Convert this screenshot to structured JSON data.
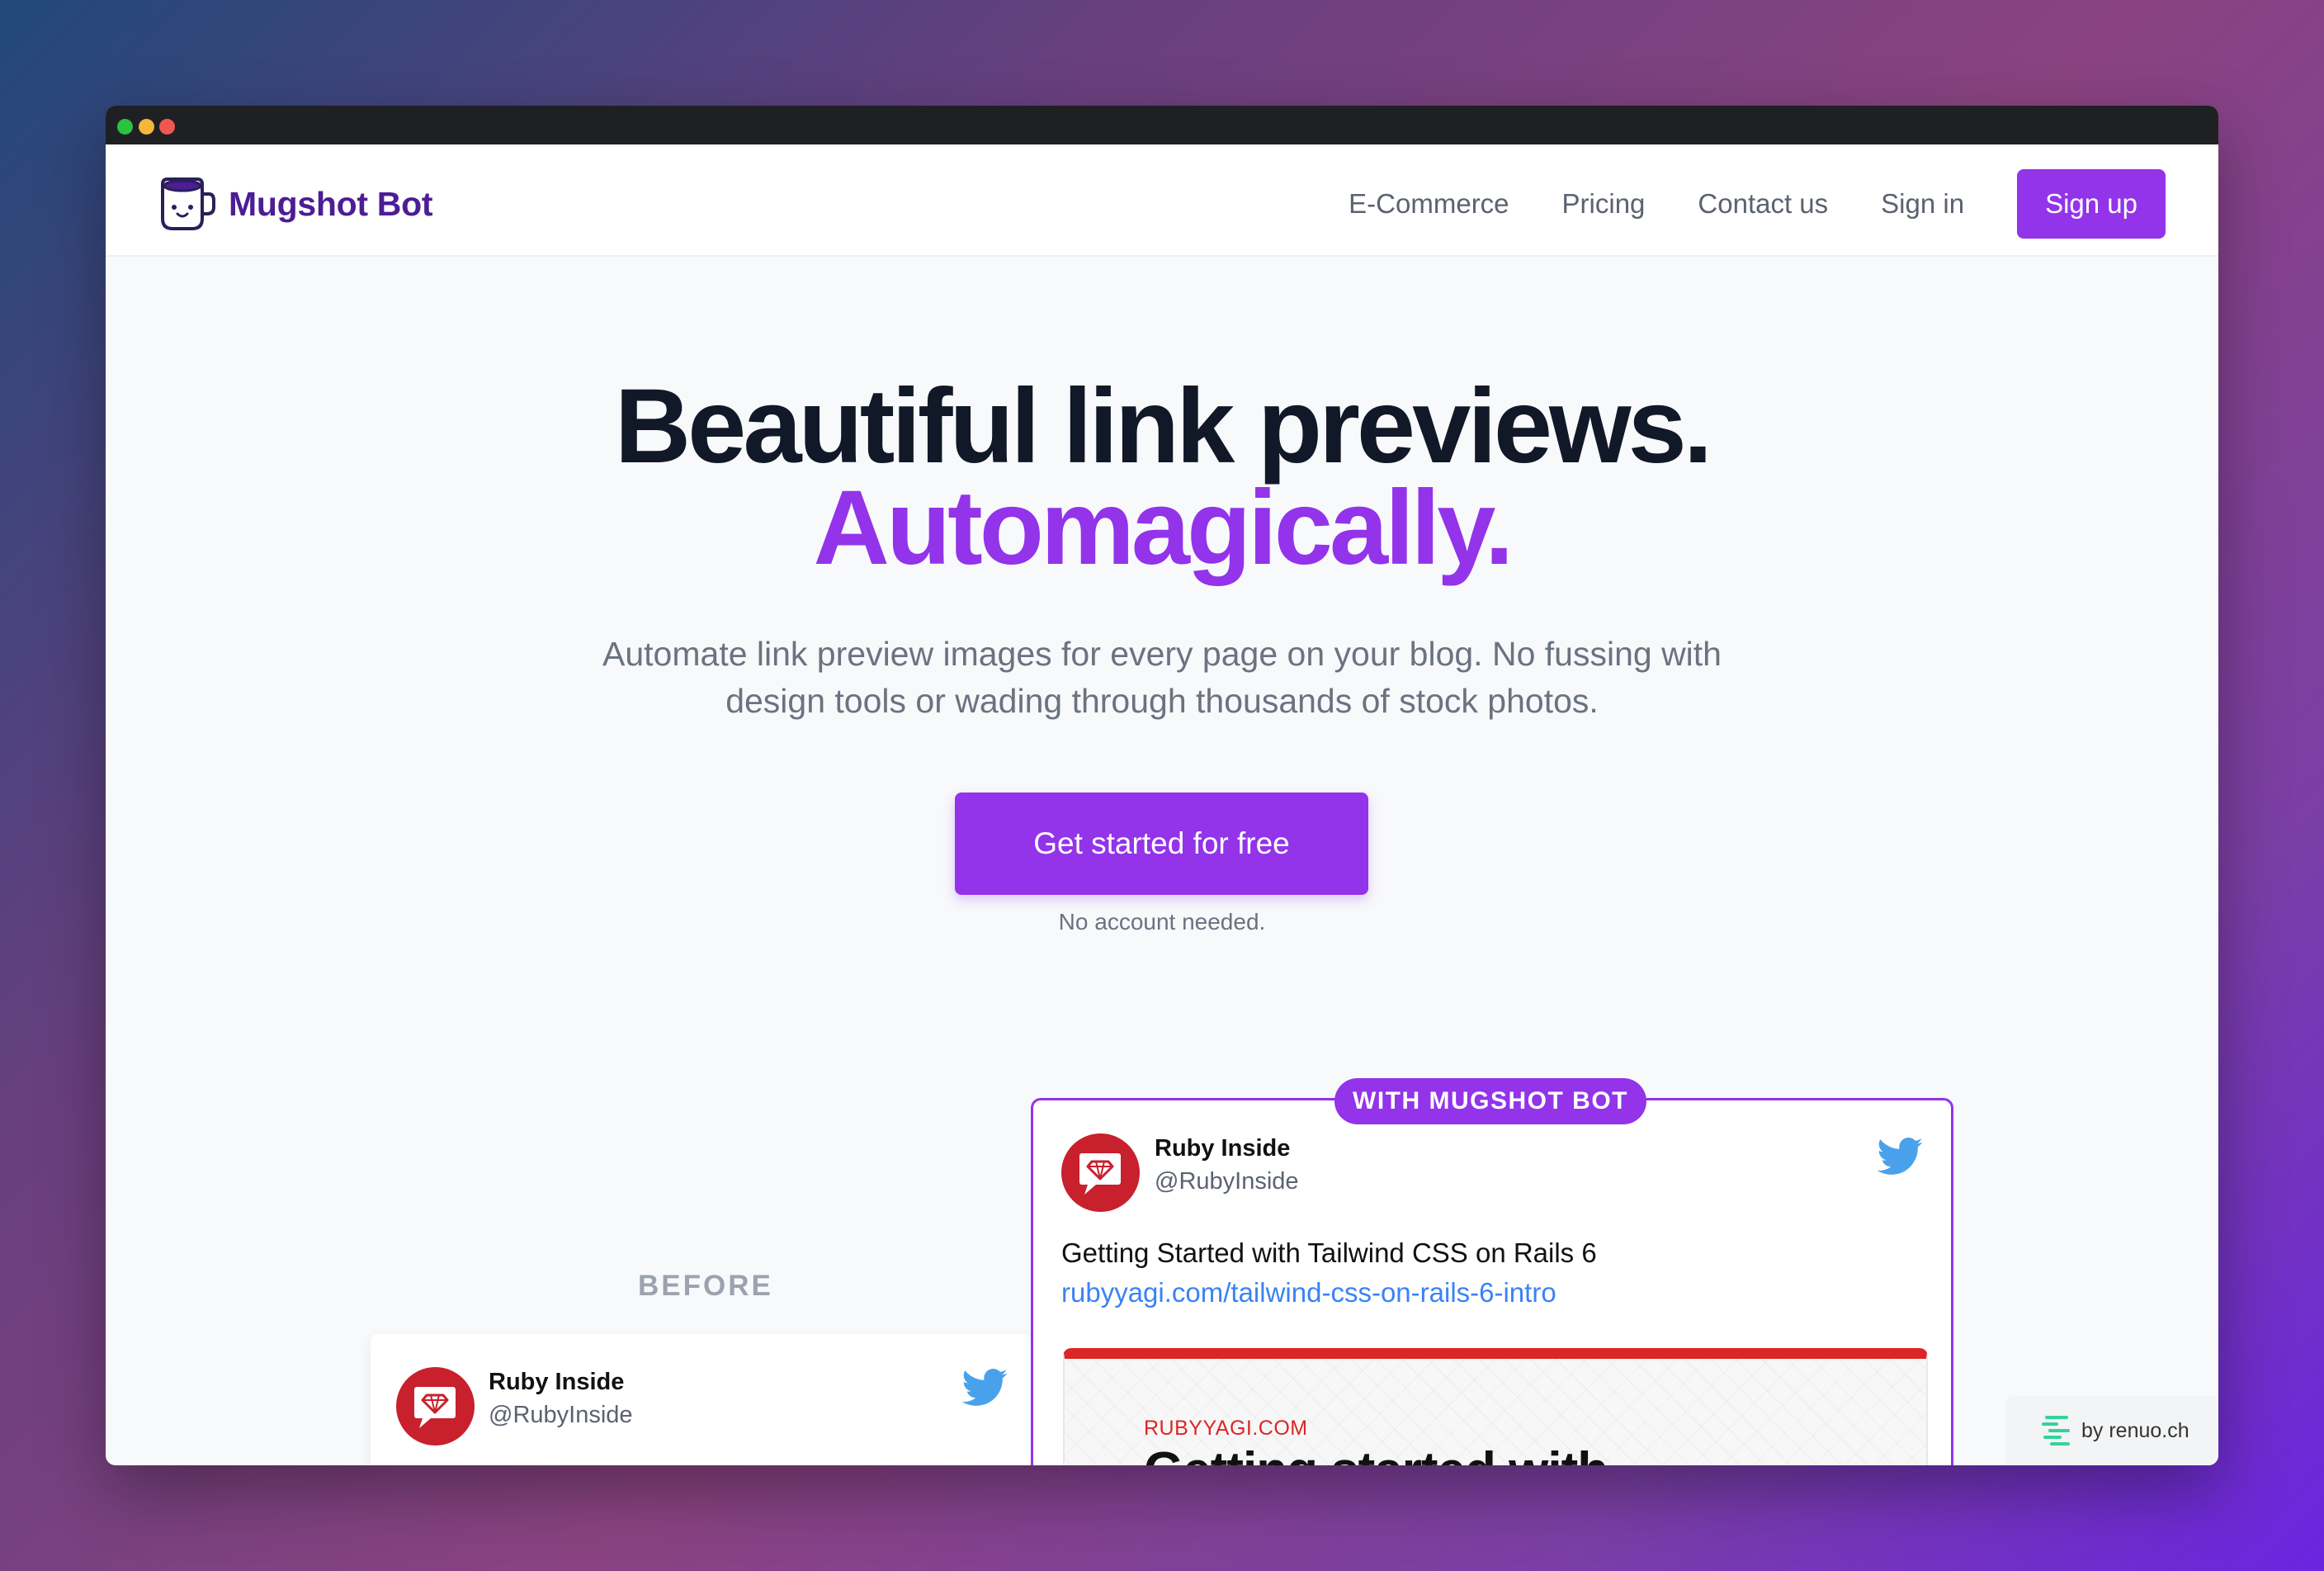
{
  "brand": {
    "name": "Mugshot Bot"
  },
  "nav": {
    "links": [
      "E-Commerce",
      "Pricing",
      "Contact us",
      "Sign in"
    ],
    "signup_label": "Sign up"
  },
  "hero": {
    "headline_line1": "Beautiful link previews.",
    "headline_line2": "Automagically.",
    "subtitle_line1": "Automate link preview images for every page on your blog. No fussing with",
    "subtitle_line2": "design tools or wading through thousands of stock photos.",
    "cta_label": "Get started for free",
    "cta_note": "No account needed."
  },
  "comparison": {
    "before_label": "BEFORE",
    "with_badge": "WITH MUGSHOT BOT",
    "tweet": {
      "name": "Ruby Inside",
      "handle": "@RubyInside",
      "text": "Getting Started with Tailwind CSS on Rails 6",
      "link": "rubyyagi.com/tailwind-css-on-rails-6-intro"
    },
    "preview": {
      "domain": "RUBYYAGI.COM",
      "title": "Getting started with"
    }
  },
  "footer_badge": {
    "text": "by renuo.ch"
  },
  "colors": {
    "accent": "#9333ea",
    "brand_text": "#4c1d95",
    "headline": "#111827",
    "link": "#3b82f6",
    "ruby_red": "#c8202d"
  },
  "icons": {
    "brand": "mug-icon",
    "tweet_source": "twitter-bird-icon",
    "avatar": "ruby-gem-icon",
    "renuo": "renuo-logo-icon"
  }
}
